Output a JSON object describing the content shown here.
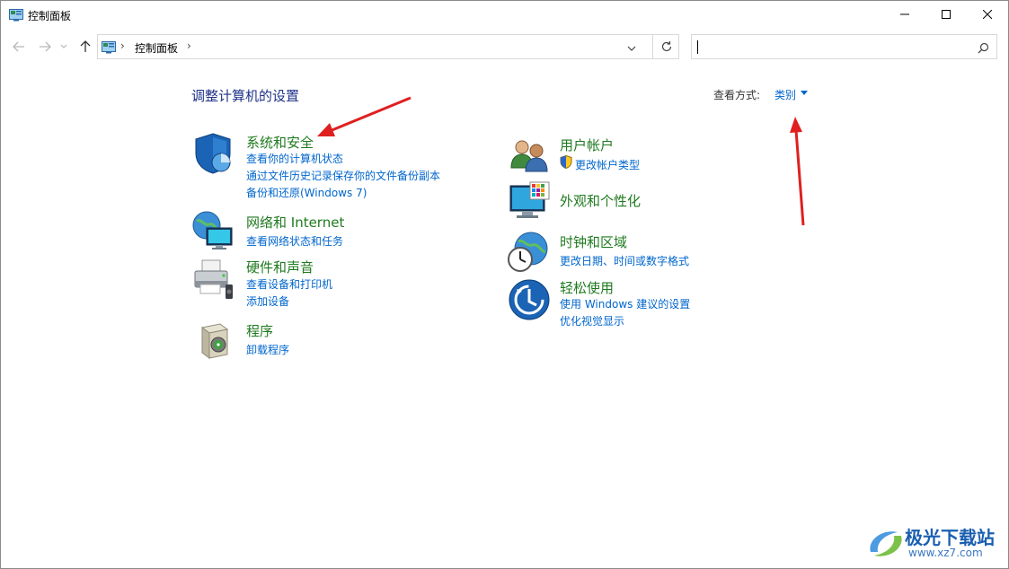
{
  "window": {
    "title": "控制面板"
  },
  "address": {
    "crumb": "控制面板"
  },
  "search": {
    "placeholder": ""
  },
  "main": {
    "heading": "调整计算机的设置",
    "view_by_label": "查看方式:",
    "view_by_value": "类别"
  },
  "categories": [
    {
      "title": "系统和安全",
      "icon": "shield-icon",
      "links": [
        "查看你的计算机状态",
        "通过文件历史记录保存你的文件备份副本",
        "备份和还原(Windows 7)"
      ]
    },
    {
      "title": "网络和 Internet",
      "icon": "network-globe-icon",
      "links": [
        "查看网络状态和任务"
      ]
    },
    {
      "title": "硬件和声音",
      "icon": "printer-icon",
      "links": [
        "查看设备和打印机",
        "添加设备"
      ]
    },
    {
      "title": "程序",
      "icon": "programs-box-icon",
      "links": [
        "卸载程序"
      ]
    },
    {
      "title": "用户帐户",
      "icon": "users-icon",
      "links": [
        "更改帐户类型"
      ]
    },
    {
      "title": "外观和个性化",
      "icon": "monitor-palette-icon",
      "links": []
    },
    {
      "title": "时钟和区域",
      "icon": "clock-globe-icon",
      "links": [
        "更改日期、时间或数字格式"
      ]
    },
    {
      "title": "轻松使用",
      "icon": "ease-of-access-icon",
      "links": [
        "使用 Windows 建议的设置",
        "优化视觉显示"
      ]
    }
  ],
  "watermark": {
    "name": "极光下载站",
    "url": "www.xz7.com"
  },
  "colors": {
    "title_green": "#1f7a1f",
    "link_blue": "#0066cc",
    "heading_blue": "#1e3287",
    "arrow_red": "#e02020"
  }
}
